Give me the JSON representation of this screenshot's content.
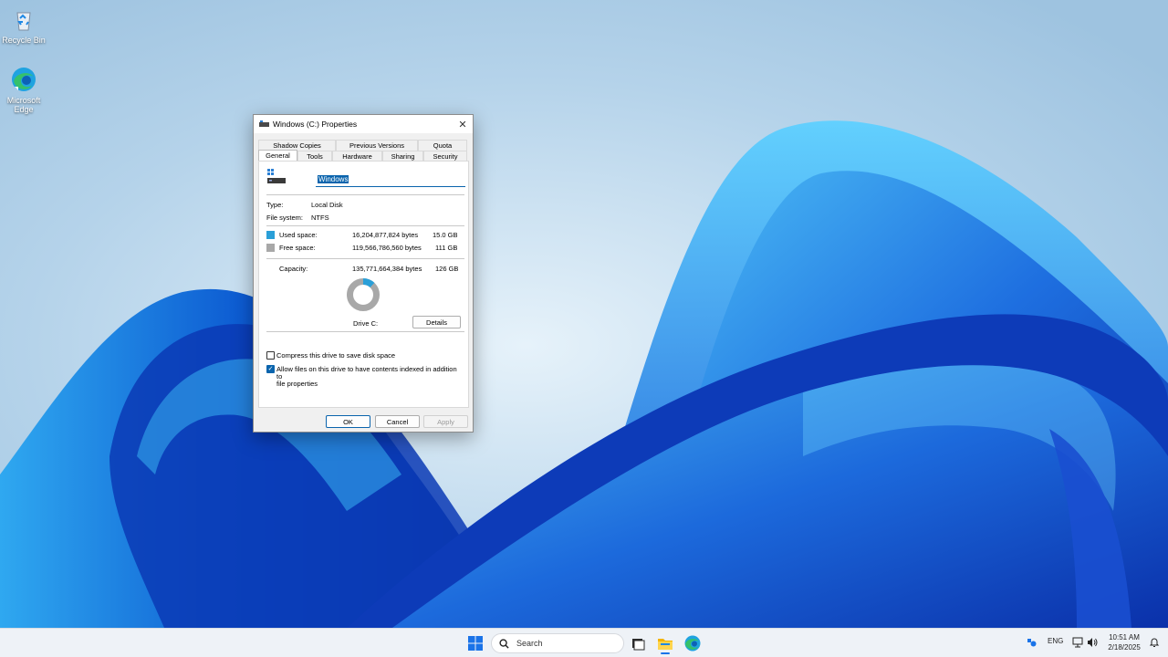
{
  "desktop": {
    "icons": [
      {
        "label": "Recycle Bin"
      },
      {
        "label": "Microsoft Edge"
      }
    ]
  },
  "dialog": {
    "title": "Windows (C:) Properties",
    "close_glyph": "✕",
    "tabs_row1": [
      "Shadow Copies",
      "Previous Versions",
      "Quota"
    ],
    "tabs_row2": [
      "General",
      "Tools",
      "Hardware",
      "Sharing",
      "Security"
    ],
    "active_tab": "General",
    "drive_name": "Windows",
    "type_label": "Type:",
    "type_value": "Local Disk",
    "fs_label": "File system:",
    "fs_value": "NTFS",
    "used_label": "Used space:",
    "used_bytes": "16,204,877,824 bytes",
    "used_size": "15.0 GB",
    "free_label": "Free space:",
    "free_bytes": "119,566,786,560 bytes",
    "free_size": "111 GB",
    "capacity_label": "Capacity:",
    "capacity_bytes": "135,771,664,384 bytes",
    "capacity_size": "126 GB",
    "used_fraction": 0.12,
    "drive_label": "Drive C:",
    "details_label": "Details",
    "compress_label": "Compress this drive to save disk space",
    "compress_checked": false,
    "index_label_line1": "Allow files on this drive to have contents indexed in addition to",
    "index_label_line2": "file properties",
    "index_checked": true,
    "ok_label": "OK",
    "cancel_label": "Cancel",
    "apply_label": "Apply",
    "colors": {
      "used": "#2a9fd8",
      "free": "#a8a8a8",
      "accent": "#0a64ad"
    }
  },
  "taskbar": {
    "search_placeholder": "Search",
    "apps": [
      "start-icon",
      "task-view-icon",
      "file-explorer-icon",
      "edge-icon"
    ],
    "tray": {
      "language": "ENG",
      "time": "10:51 AM",
      "date": "2/18/2025"
    }
  }
}
